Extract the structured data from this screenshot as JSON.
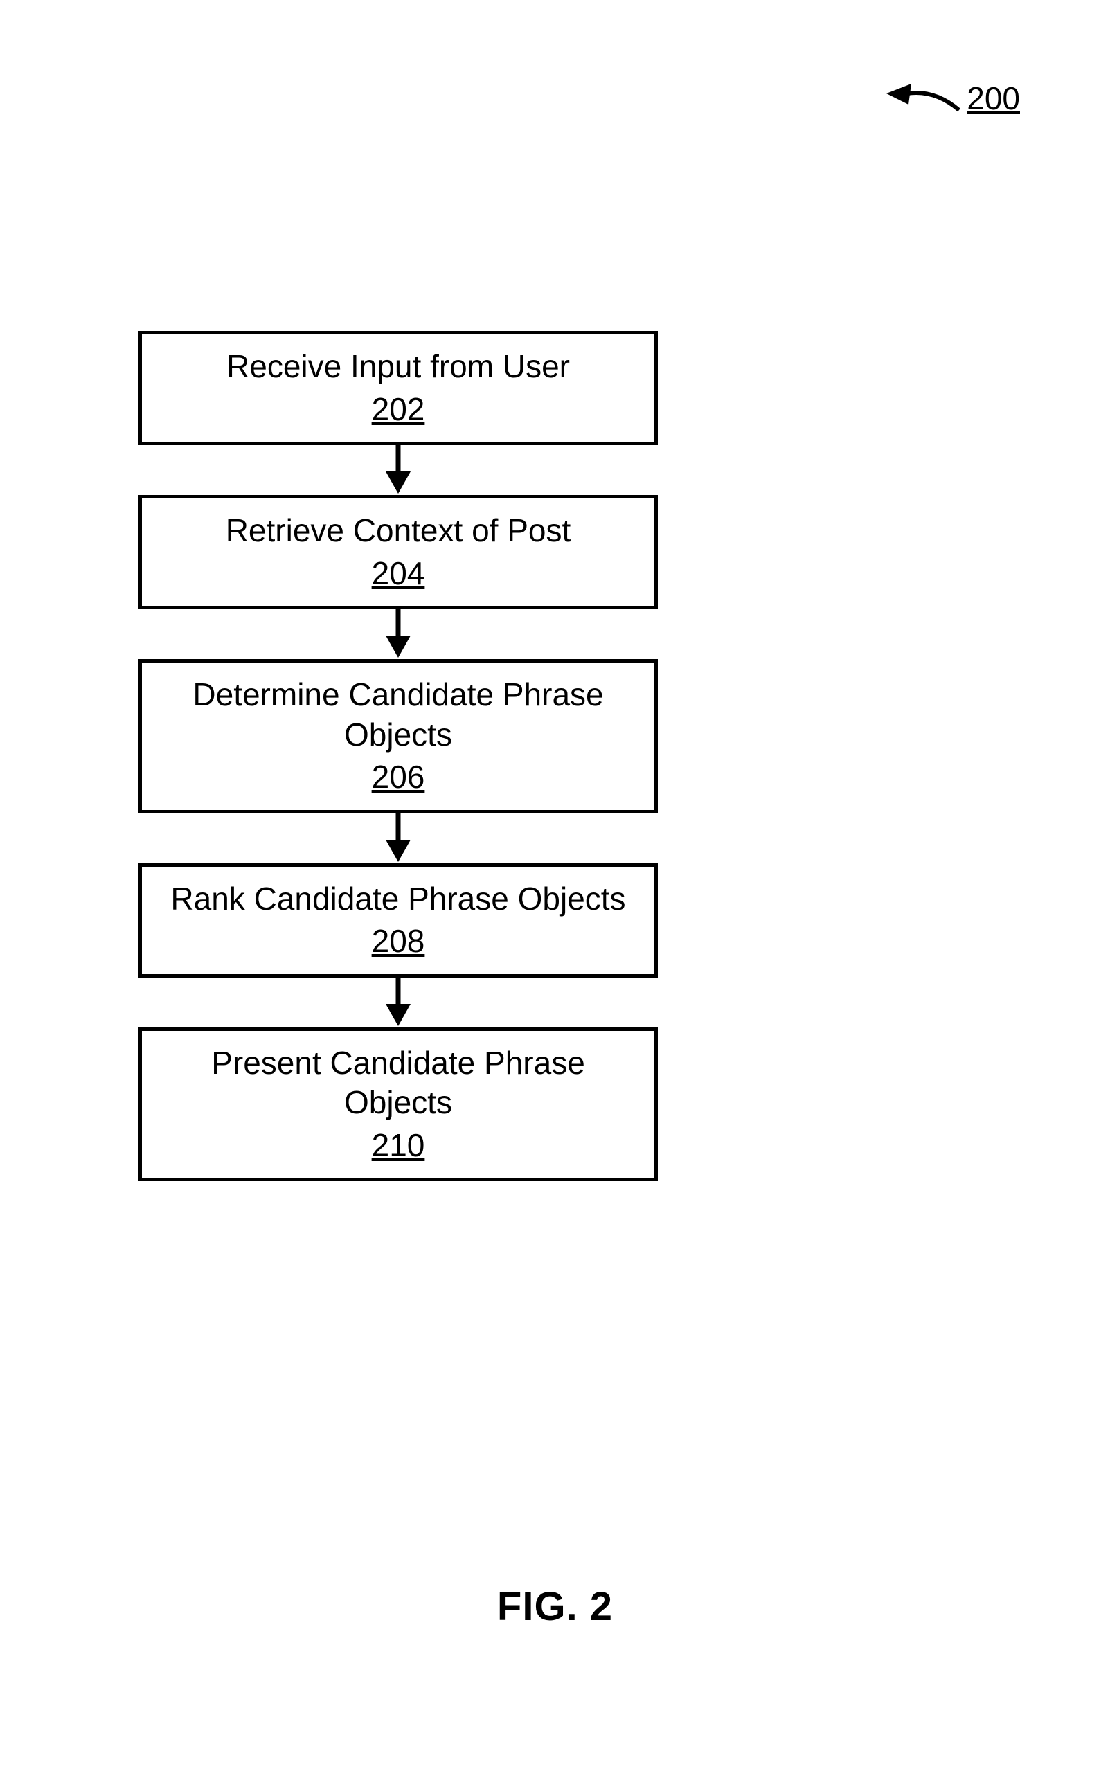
{
  "chart_data": {
    "type": "flowchart",
    "title": "FIG. 2",
    "reference_number": "200",
    "steps": [
      {
        "id": "202",
        "label": "Receive Input from User"
      },
      {
        "id": "204",
        "label": "Retrieve Context of Post"
      },
      {
        "id": "206",
        "label": "Determine Candidate Phrase Objects"
      },
      {
        "id": "208",
        "label": "Rank Candidate Phrase Objects"
      },
      {
        "id": "210",
        "label": "Present Candidate Phrase Objects"
      }
    ],
    "edges": [
      [
        "202",
        "204"
      ],
      [
        "204",
        "206"
      ],
      [
        "206",
        "208"
      ],
      [
        "208",
        "210"
      ]
    ]
  },
  "ref": {
    "number": "200"
  },
  "steps": {
    "s1": {
      "label": "Receive Input from User",
      "num": "202"
    },
    "s2": {
      "label": "Retrieve Context of Post",
      "num": "204"
    },
    "s3": {
      "label": "Determine Candidate Phrase Objects",
      "num": "206"
    },
    "s4": {
      "label": "Rank Candidate Phrase Objects",
      "num": "208"
    },
    "s5": {
      "label": "Present Candidate Phrase Objects",
      "num": "210"
    }
  },
  "caption": "FIG. 2"
}
